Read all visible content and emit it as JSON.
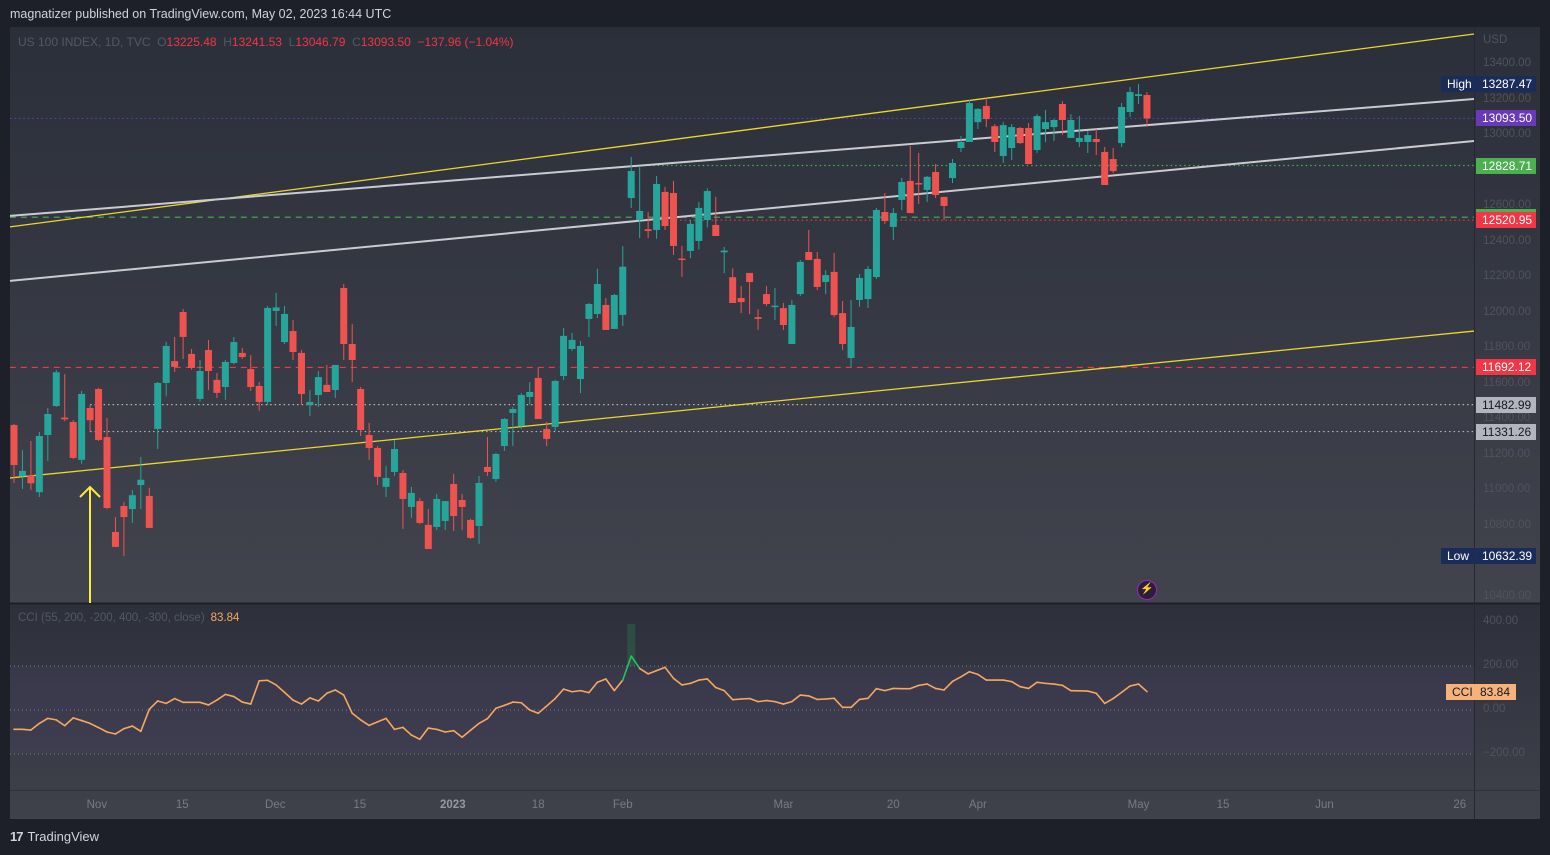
{
  "header": {
    "publisher_line": "magnatizer published on TradingView.com, May 02, 2023 16:44 UTC"
  },
  "legend": {
    "symbol": "US 100 INDEX, 1D, TVC",
    "o_label": "O",
    "open": "13225.48",
    "h_label": "H",
    "high": "13241.53",
    "l_label": "L",
    "low": "13046.79",
    "c_label": "C",
    "close": "13093.50",
    "change": "−137.96 (−1.04%)"
  },
  "cci_legend": {
    "label": "CCI (55, 200, -200, 400, -300, close)",
    "value": "83.84"
  },
  "footer": {
    "brand": "TradingView"
  },
  "colors": {
    "up": "#26a69a",
    "down": "#ef5350",
    "cci": "#f7a85e",
    "channel_yellow": "#f0d72c",
    "channel_white": "#c9cbd1"
  },
  "chart_data": {
    "type": "candlestick",
    "title": "US 100 INDEX, 1D, TVC",
    "currency": "USD",
    "ylim": [
      10380,
      13500
    ],
    "y_ticks": [
      "13400.00",
      "13200.00",
      "13000.00",
      "12800.00",
      "12600.00",
      "12400.00",
      "12200.00",
      "12000.00",
      "11800.00",
      "11600.00",
      "11400.00",
      "11200.00",
      "11000.00",
      "10800.00",
      "10600.00",
      "10400.00"
    ],
    "x_labels": [
      {
        "label": "Nov",
        "index": 9.8
      },
      {
        "label": "15",
        "index": 19.9
      },
      {
        "label": "Dec",
        "index": 30.9
      },
      {
        "label": "15",
        "index": 40.9
      },
      {
        "label": "2023",
        "index": 51.9,
        "bold": true
      },
      {
        "label": "18",
        "index": 62
      },
      {
        "label": "Feb",
        "index": 72
      },
      {
        "label": "Mar",
        "index": 91
      },
      {
        "label": "20",
        "index": 104
      },
      {
        "label": "Apr",
        "index": 114
      },
      {
        "label": "May",
        "index": 133
      },
      {
        "label": "15",
        "index": 143
      },
      {
        "label": "Jun",
        "index": 155
      },
      {
        "label": "26",
        "index": 171
      }
    ],
    "ohlc": [
      [
        11368,
        11374,
        11042,
        11143
      ],
      [
        11080,
        11228,
        11008,
        11110
      ],
      [
        11085,
        11278,
        11003,
        11040
      ],
      [
        10990,
        11329,
        10963,
        11306
      ],
      [
        11312,
        11464,
        11166,
        11430
      ],
      [
        11475,
        11678,
        11470,
        11665
      ],
      [
        11410,
        11655,
        11390,
        11400
      ],
      [
        11385,
        11396,
        11177,
        11183
      ],
      [
        11172,
        11560,
        11150,
        11543
      ],
      [
        11464,
        11481,
        11330,
        11395
      ],
      [
        11571,
        11577,
        11278,
        11284
      ],
      [
        11300,
        11408,
        10895,
        10901
      ],
      [
        10766,
        10850,
        10682,
        10682
      ],
      [
        10912,
        10935,
        10630,
        10850
      ],
      [
        10895,
        11002,
        10817,
        10973
      ],
      [
        11030,
        11188,
        10895,
        11060
      ],
      [
        10969,
        11014,
        10789,
        10789
      ],
      [
        11346,
        11610,
        11233,
        11605
      ],
      [
        11605,
        11836,
        11530,
        11813
      ],
      [
        11728,
        11864,
        11667,
        11695
      ],
      [
        12004,
        12021,
        11740,
        11864
      ],
      [
        11768,
        11796,
        11680,
        11689
      ],
      [
        11515,
        11734,
        11500,
        11672
      ],
      [
        11790,
        11847,
        11565,
        11672
      ],
      [
        11622,
        11661,
        11520,
        11549
      ],
      [
        11582,
        11734,
        11510,
        11723
      ],
      [
        11717,
        11864,
        11710,
        11835
      ],
      [
        11774,
        11802,
        11740,
        11751
      ],
      [
        11683,
        11762,
        11560,
        11582
      ],
      [
        11588,
        11610,
        11448,
        11498
      ],
      [
        11498,
        12038,
        11480,
        12027
      ],
      [
        12010,
        12112,
        11925,
        12030
      ],
      [
        11835,
        12038,
        11824,
        11993
      ],
      [
        11897,
        11959,
        11734,
        11779
      ],
      [
        11774,
        11790,
        11486,
        11543
      ],
      [
        11480,
        11565,
        11420,
        11498
      ],
      [
        11537,
        11672,
        11470,
        11638
      ],
      [
        11594,
        11706,
        11560,
        11554
      ],
      [
        11565,
        11706,
        11520,
        11706
      ],
      [
        12139,
        12162,
        11734,
        11824
      ],
      [
        11824,
        11936,
        11610,
        11734
      ],
      [
        11571,
        11582,
        11306,
        11340
      ],
      [
        11312,
        11380,
        11172,
        11239
      ],
      [
        11239,
        11250,
        11031,
        11076
      ],
      [
        11020,
        11138,
        10963,
        11070
      ],
      [
        11104,
        11284,
        11082,
        11233
      ],
      [
        11098,
        11115,
        10783,
        10952
      ],
      [
        10907,
        11020,
        10845,
        10986
      ],
      [
        10940,
        10957,
        10811,
        10817
      ],
      [
        10806,
        10895,
        10670,
        10670
      ],
      [
        10794,
        10980,
        10777,
        10952
      ],
      [
        10828,
        10940,
        10777,
        10940
      ],
      [
        11036,
        11093,
        10771,
        10856
      ],
      [
        10946,
        10980,
        10777,
        10907
      ],
      [
        10834,
        10840,
        10727,
        10733
      ],
      [
        10800,
        11082,
        10699,
        11042
      ],
      [
        11132,
        11301,
        11082,
        11104
      ],
      [
        11064,
        11211,
        11048,
        11205
      ],
      [
        11250,
        11408,
        11222,
        11402
      ],
      [
        11436,
        11470,
        11250,
        11458
      ],
      [
        11363,
        11548,
        11346,
        11537
      ],
      [
        11526,
        11610,
        11482,
        11554
      ],
      [
        11633,
        11689,
        11402,
        11402
      ],
      [
        11346,
        11385,
        11250,
        11290
      ],
      [
        11357,
        11622,
        11335,
        11616
      ],
      [
        11644,
        11914,
        11622,
        11870
      ],
      [
        11796,
        11886,
        11785,
        11847
      ],
      [
        11627,
        11841,
        11548,
        11813
      ],
      [
        11965,
        12055,
        11863,
        12049
      ],
      [
        11993,
        12247,
        11970,
        12162
      ],
      [
        12044,
        12083,
        11903,
        11903
      ],
      [
        11909,
        12106,
        11909,
        12100
      ],
      [
        11988,
        12375,
        11925,
        12259
      ],
      [
        12646,
        12877,
        12590,
        12798
      ],
      [
        12522,
        12826,
        12420,
        12573
      ],
      [
        12470,
        12566,
        12420,
        12460
      ],
      [
        12466,
        12770,
        12416,
        12725
      ],
      [
        12680,
        12708,
        12466,
        12488
      ],
      [
        12674,
        12742,
        12325,
        12376
      ],
      [
        12305,
        12376,
        12202,
        12300
      ],
      [
        12348,
        12522,
        12308,
        12500
      ],
      [
        12404,
        12624,
        12356,
        12590
      ],
      [
        12522,
        12700,
        12480,
        12685
      ],
      [
        12494,
        12652,
        12432,
        12432
      ],
      [
        12340,
        12370,
        12223,
        12350
      ],
      [
        12200,
        12250,
        12055,
        12055
      ],
      [
        12083,
        12150,
        11998,
        12060
      ],
      [
        12224,
        12224,
        11992,
        12173
      ],
      [
        11975,
        12020,
        11903,
        11965
      ],
      [
        12105,
        12150,
        12038,
        12049
      ],
      [
        12035,
        12140,
        11960,
        12040
      ],
      [
        12026,
        12055,
        11903,
        11931
      ],
      [
        11824,
        12072,
        11824,
        12044
      ],
      [
        12105,
        12297,
        12094,
        12286
      ],
      [
        12342,
        12466,
        12297,
        12297
      ],
      [
        12303,
        12342,
        12128,
        12145
      ],
      [
        12173,
        12240,
        12105,
        12212
      ],
      [
        12230,
        12336,
        11975,
        11987
      ],
      [
        11998,
        12066,
        11790,
        11824
      ],
      [
        11745,
        12072,
        11695,
        11920
      ],
      [
        12072,
        12218,
        12033,
        12196
      ],
      [
        12077,
        12263,
        12027,
        12246
      ],
      [
        12201,
        12590,
        12190,
        12578
      ],
      [
        12567,
        12674,
        12500,
        12516
      ],
      [
        12483,
        12590,
        12410,
        12561
      ],
      [
        12635,
        12759,
        12578,
        12736
      ],
      [
        12742,
        12939,
        12561,
        12561
      ],
      [
        12730,
        12900,
        12612,
        12725
      ],
      [
        12691,
        12770,
        12624,
        12765
      ],
      [
        12792,
        12837,
        12646,
        12663
      ],
      [
        12652,
        12652,
        12522,
        12601
      ],
      [
        12758,
        12865,
        12730,
        12843
      ],
      [
        12927,
        12995,
        12905,
        12961
      ],
      [
        12961,
        13197,
        12961,
        13180
      ],
      [
        13073,
        13152,
        13034,
        13147
      ],
      [
        13164,
        13208,
        13045,
        13090
      ],
      [
        13050,
        13062,
        12905,
        12961
      ],
      [
        12882,
        13073,
        12843,
        13056
      ],
      [
        12927,
        13062,
        12860,
        13045
      ],
      [
        13040,
        13045,
        12950,
        12955
      ],
      [
        13040,
        13068,
        12837,
        12837
      ],
      [
        12916,
        13118,
        12900,
        13107
      ],
      [
        13034,
        13141,
        12960,
        13073
      ],
      [
        13045,
        13090,
        12967,
        13085
      ],
      [
        13175,
        13191,
        13000,
        13085
      ],
      [
        12984,
        13118,
        12984,
        13085
      ],
      [
        12961,
        13107,
        12933,
        12984
      ],
      [
        12961,
        13022,
        12899,
        13000
      ],
      [
        12978,
        13034,
        12888,
        12961
      ],
      [
        12905,
        12933,
        12719,
        12719
      ],
      [
        12865,
        12927,
        12786,
        12797
      ],
      [
        12955,
        13180,
        12933,
        13158
      ],
      [
        13130,
        13270,
        13102,
        13242
      ],
      [
        13220,
        13287,
        13175,
        13230
      ],
      [
        13225.48,
        13241.53,
        13046.79,
        13093.5
      ]
    ],
    "trendlines": [
      {
        "name": "upper-yellow-channel",
        "color": "#f0d72c",
        "points": [
          [
            -0.5,
            12483
          ],
          [
            172.7,
            13569
          ]
        ]
      },
      {
        "name": "upper-white-channel",
        "color": "#c9cbd1",
        "points": [
          [
            -0.5,
            12545
          ],
          [
            172.7,
            13203
          ]
        ]
      },
      {
        "name": "lower-white-channel",
        "color": "#c9cbd1",
        "points": [
          [
            -0.5,
            12179
          ],
          [
            172.7,
            12967
          ]
        ]
      },
      {
        "name": "lower-yellow-channel",
        "color": "#f0d72c",
        "points": [
          [
            -0.5,
            11070
          ],
          [
            172.7,
            11897
          ]
        ]
      }
    ],
    "levels": [
      {
        "name": "last-price",
        "price": 13093.5,
        "text": "13093.50",
        "color": "#673ab7",
        "style": "dotted",
        "from": -0.5
      },
      {
        "name": "level-12828",
        "price": 12828.71,
        "text": "12828.71",
        "color": "#4caf50",
        "style": "dotted",
        "from": 74
      },
      {
        "name": "level-12537",
        "price": 12537.89,
        "text": "12537.89",
        "color": "#4caf50",
        "style": "dashed",
        "from": -0.5
      },
      {
        "name": "level-12520",
        "price": 12520.95,
        "text": "12520.95",
        "color": "#f23645",
        "style": "dotted",
        "from": 74
      },
      {
        "name": "level-11692",
        "price": 11692.12,
        "text": "11692.12",
        "color": "#f23645",
        "style": "dashed",
        "from": -0.5
      },
      {
        "name": "level-11482",
        "price": 11482.99,
        "text": "11482.99",
        "color": "#b2b5be",
        "style": "dotted",
        "from": 9
      },
      {
        "name": "level-11331",
        "price": 11331.26,
        "text": "11331.26",
        "color": "#b2b5be",
        "style": "dotted",
        "from": 9
      }
    ],
    "high_marker": {
      "label": "High",
      "price": 13287.47,
      "text": "13287.47"
    },
    "low_marker": {
      "label": "Low",
      "price": 10632.39,
      "text": "10632.39"
    },
    "cci": {
      "ylim": [
        -450,
        450
      ],
      "y_ticks": [
        "400.00",
        "200.00",
        "0.00",
        "−200.00"
      ],
      "bands": [
        200,
        0,
        -200
      ],
      "badge_label": "CCI",
      "badge_value": "83.84",
      "values": [
        -88,
        -88,
        -91,
        -61,
        -38,
        -45,
        -71,
        -36,
        -48,
        -61,
        -80,
        -100,
        -109,
        -85,
        -73,
        -97,
        3,
        41,
        30,
        52,
        35,
        35,
        35,
        23,
        45,
        71,
        61,
        36,
        27,
        133,
        135,
        114,
        80,
        45,
        27,
        55,
        41,
        76,
        91,
        68,
        -15,
        -45,
        -70,
        -54,
        -38,
        -88,
        -79,
        -114,
        -133,
        -82,
        -88,
        -100,
        -94,
        -124,
        -92,
        -61,
        -39,
        8,
        21,
        36,
        33,
        0,
        -15,
        18,
        52,
        95,
        83,
        88,
        79,
        126,
        141,
        88,
        136,
        245,
        189,
        164,
        179,
        194,
        144,
        114,
        121,
        136,
        141,
        102,
        88,
        47,
        50,
        52,
        38,
        43,
        38,
        27,
        38,
        68,
        64,
        48,
        50,
        53,
        12,
        12,
        48,
        53,
        97,
        88,
        98,
        97,
        97,
        112,
        118,
        98,
        91,
        130,
        151,
        174,
        162,
        136,
        136,
        136,
        129,
        106,
        98,
        126,
        121,
        118,
        112,
        88,
        87,
        86,
        76,
        30,
        52,
        80,
        109,
        118,
        83.84
      ]
    }
  }
}
